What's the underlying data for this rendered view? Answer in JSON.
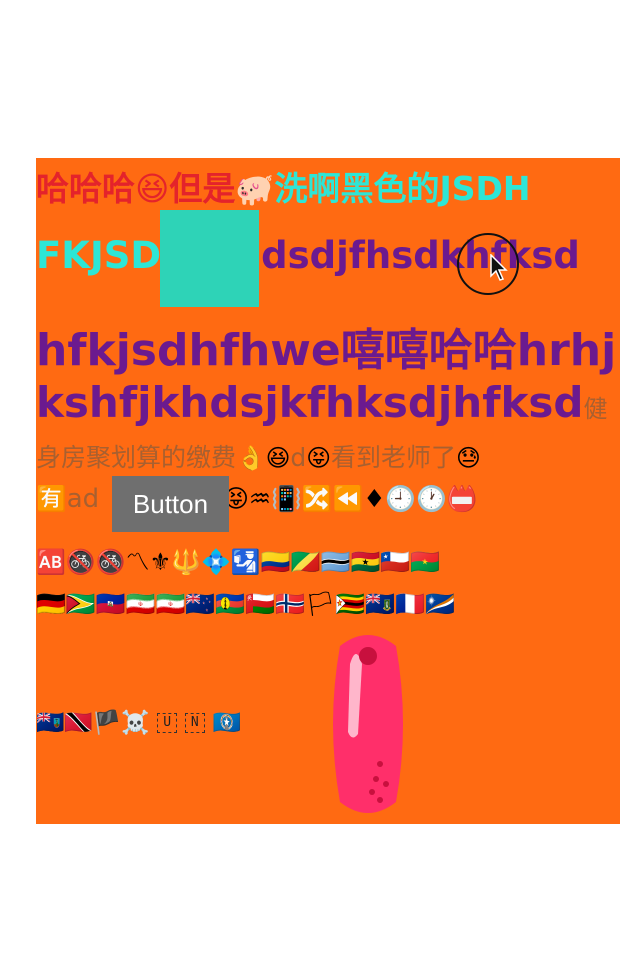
{
  "lines": {
    "l1_red": "哈哈哈😆但是",
    "l1_piggy": "🐖",
    "l1_cyan": "洗啊黑色的JSDH",
    "l2_cyan": "FKJSD",
    "l2_purple": "dsdjfhsdkhfksd",
    "l3_purple": "hfkjsdhfhwe嘻嘻哈哈hrhj",
    "l4_purple": "kshfjkhdsjkfhksdjhfksd",
    "l4_olive": "健",
    "l5_olive": "身房聚划算的缴费",
    "l5_emoji1": "👌😆",
    "l5_d": "d",
    "l5_emoji2": "😝",
    "l5_tail": "看到老师了",
    "l5_emoji3": "😓",
    "l6_pre": "🈶",
    "l6_ad": "ad",
    "l6_post": "😝♒📳🔀⏪♦🕘🕐📛",
    "l7": "🆎🚳🚳〽⚜🔱💠🛂🇨🇴🇨🇬🇧🇼🇬🇭🇨🇱🇧🇫",
    "l8": "🇩🇪🇬🇾🇭🇹🇮🇷🇮🇷🇳🇿🇳🇨🇴🇲🇳🇴🏳🇿🇼🇻🇬🇲🇫🇲🇭",
    "l9_pre": "🇲🇸🇹🇹🏴☠️",
    "l9_tile1": "U",
    "l9_tile2": "N",
    "l9_post": "🇲🇵"
  },
  "button": {
    "label": "Button"
  },
  "colors": {
    "stage": "#ff6a12",
    "red_text": "#e4232b",
    "cyan_text": "#2de6d6",
    "purple_text": "#6b1a8f",
    "olive_text": "#a86030",
    "teal_box": "#2ed3b7",
    "button_bg": "#6f6f6f",
    "pill": "#ff2f6a"
  }
}
